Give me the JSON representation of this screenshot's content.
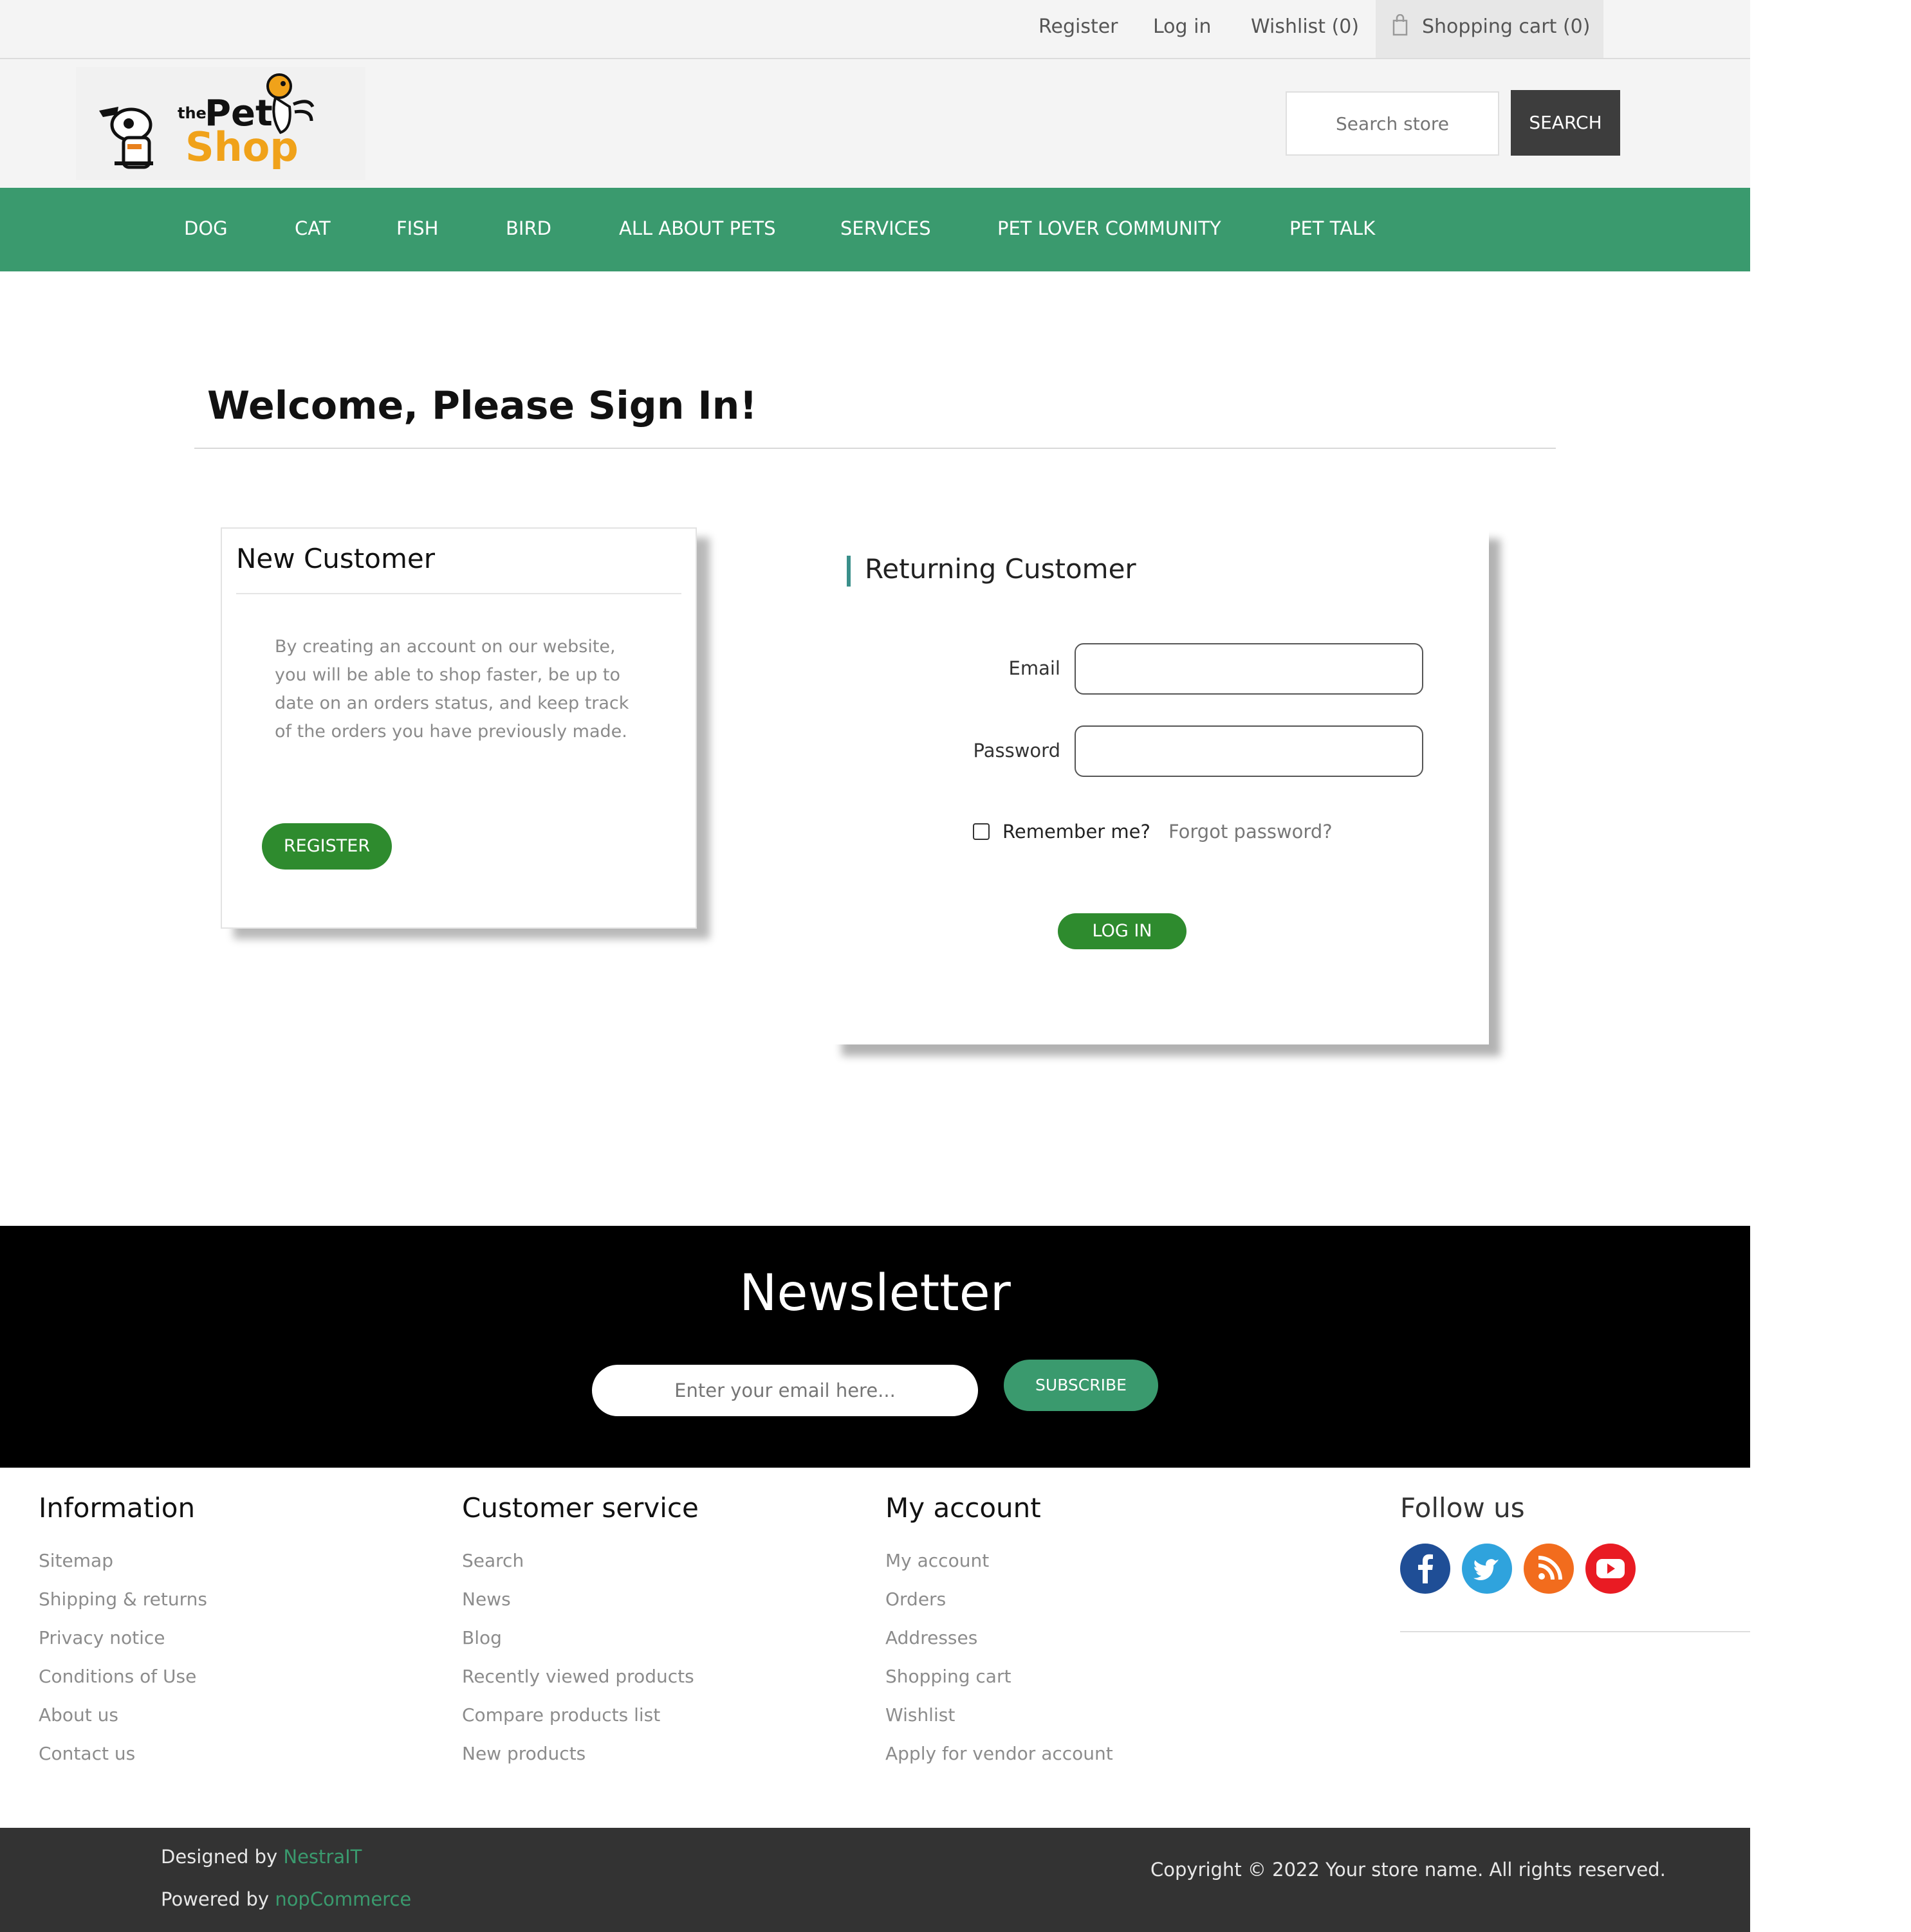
{
  "header": {
    "links": {
      "register": "Register",
      "login": "Log in",
      "wishlist": "Wishlist",
      "wishlist_count": "(0)"
    },
    "cart": {
      "label": "Shopping cart",
      "count": "(0)"
    },
    "logo": {
      "small": "the",
      "main": "Pet",
      "sub": "Shop"
    },
    "search": {
      "placeholder": "Search store",
      "button": "SEARCH"
    }
  },
  "nav": {
    "items": [
      "DOG",
      "CAT",
      "FISH",
      "BIRD",
      "ALL ABOUT PETS",
      "SERVICES",
      "PET LOVER COMMUNITY",
      "PET TALK"
    ]
  },
  "main": {
    "title": "Welcome, Please Sign In!",
    "new_customer": {
      "title": "New Customer",
      "text": "By creating an account on our website, you will be able to shop faster, be up to date on an orders status, and keep track of the orders you have previously made.",
      "button": "REGISTER"
    },
    "returning_customer": {
      "title": "Returning Customer",
      "email_label": "Email",
      "password_label": "Password",
      "remember_label": "Remember me?",
      "forgot_link": "Forgot password?",
      "button": "LOG IN"
    }
  },
  "newsletter": {
    "title": "Newsletter",
    "placeholder": "Enter your email here...",
    "button": "SUBSCRIBE"
  },
  "footer": {
    "information": {
      "title": "Information",
      "links": [
        "Sitemap",
        "Shipping & returns",
        "Privacy notice",
        "Conditions of Use",
        "About us",
        "Contact us"
      ]
    },
    "customer_service": {
      "title": "Customer service",
      "links": [
        "Search",
        "News",
        "Blog",
        "Recently viewed products",
        "Compare products list",
        "New products"
      ]
    },
    "my_account": {
      "title": "My account",
      "links": [
        "My account",
        "Orders",
        "Addresses",
        "Shopping cart",
        "Wishlist",
        "Apply for vendor account"
      ]
    },
    "follow": {
      "title": "Follow us",
      "icons": [
        "facebook-icon",
        "twitter-icon",
        "rss-icon",
        "youtube-icon"
      ],
      "colors": {
        "facebook": "#1f4e96",
        "twitter": "#2fa3dd",
        "rss": "#f26c1d",
        "youtube": "#e91b23"
      }
    }
  },
  "bottom": {
    "designed_prefix": "Designed by",
    "designed_link": "NestraIT",
    "powered_prefix": "Powered by",
    "powered_link": "nopCommerce",
    "copyright": "Copyright © 2022 Your store name. All rights reserved."
  },
  "colors": {
    "nav_green": "#3a9a6e",
    "button_green": "#2e8b2e",
    "search_button": "#3d3d3d",
    "footer_bottom": "#333333"
  }
}
